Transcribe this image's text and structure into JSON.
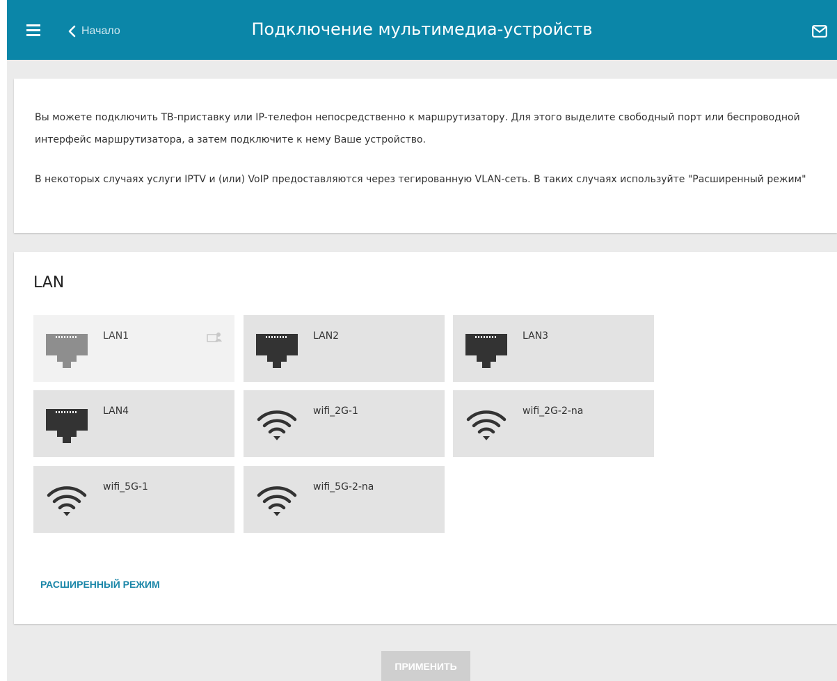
{
  "header": {
    "back_label": "Начало",
    "title": "Подключение мультимедиа-устройств",
    "background": "#0b86a8"
  },
  "intro": {
    "paragraph1": "Вы можете подключить ТВ-приставку или IP-телефон непосредственно к маршрутизатору. Для этого выделите свободный порт или беспроводной интерфейс маршрутизатора, а затем подключите к нему Ваше устройство.",
    "paragraph2": "В некоторых случаях услуги IPTV и (или) VoIP предоставляются через тегированную VLAN-сеть. В таких случаях используйте \"Расширенный режим\""
  },
  "lan_section": {
    "title": "LAN",
    "interfaces": [
      {
        "label": "LAN1",
        "type": "ethernet",
        "disabled": true,
        "icon": "ethernet-port-icon",
        "badge_icon": "computer-user-icon"
      },
      {
        "label": "LAN2",
        "type": "ethernet",
        "disabled": false,
        "icon": "ethernet-port-icon"
      },
      {
        "label": "LAN3",
        "type": "ethernet",
        "disabled": false,
        "icon": "ethernet-port-icon"
      },
      {
        "label": "LAN4",
        "type": "ethernet",
        "disabled": false,
        "icon": "ethernet-port-icon"
      },
      {
        "label": "wifi_2G-1",
        "type": "wifi",
        "disabled": false,
        "icon": "wifi-icon"
      },
      {
        "label": "wifi_2G-2-na",
        "type": "wifi",
        "disabled": false,
        "icon": "wifi-icon"
      },
      {
        "label": "wifi_5G-1",
        "type": "wifi",
        "disabled": false,
        "icon": "wifi-icon"
      },
      {
        "label": "wifi_5G-2-na",
        "type": "wifi",
        "disabled": false,
        "icon": "wifi-icon"
      }
    ],
    "advanced_link": "РАСШИРЕННЫЙ РЕЖИМ"
  },
  "apply_button": {
    "label": "ПРИМЕНИТЬ",
    "disabled": true
  },
  "colors": {
    "accent": "#0b86a8",
    "link": "#1a86a8",
    "tile": "#e3e3e3",
    "tile_disabled": "#f2f2f2"
  }
}
